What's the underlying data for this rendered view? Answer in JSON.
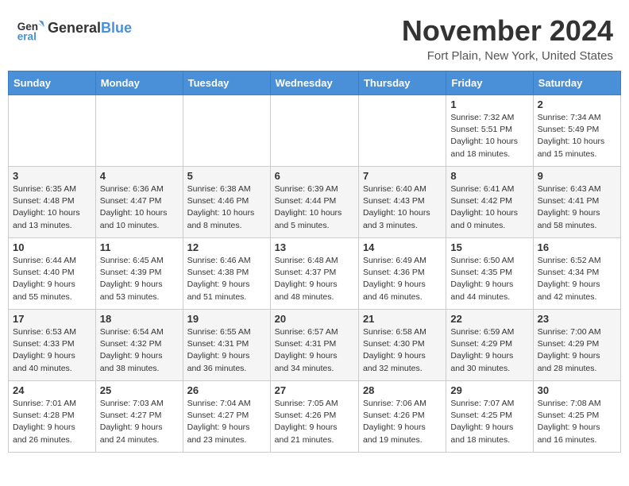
{
  "header": {
    "logo_general": "General",
    "logo_blue": "Blue",
    "month_title": "November 2024",
    "location": "Fort Plain, New York, United States"
  },
  "days_of_week": [
    "Sunday",
    "Monday",
    "Tuesday",
    "Wednesday",
    "Thursday",
    "Friday",
    "Saturday"
  ],
  "weeks": [
    [
      {
        "day": "",
        "info": ""
      },
      {
        "day": "",
        "info": ""
      },
      {
        "day": "",
        "info": ""
      },
      {
        "day": "",
        "info": ""
      },
      {
        "day": "",
        "info": ""
      },
      {
        "day": "1",
        "info": "Sunrise: 7:32 AM\nSunset: 5:51 PM\nDaylight: 10 hours\nand 18 minutes."
      },
      {
        "day": "2",
        "info": "Sunrise: 7:34 AM\nSunset: 5:49 PM\nDaylight: 10 hours\nand 15 minutes."
      }
    ],
    [
      {
        "day": "3",
        "info": "Sunrise: 6:35 AM\nSunset: 4:48 PM\nDaylight: 10 hours\nand 13 minutes."
      },
      {
        "day": "4",
        "info": "Sunrise: 6:36 AM\nSunset: 4:47 PM\nDaylight: 10 hours\nand 10 minutes."
      },
      {
        "day": "5",
        "info": "Sunrise: 6:38 AM\nSunset: 4:46 PM\nDaylight: 10 hours\nand 8 minutes."
      },
      {
        "day": "6",
        "info": "Sunrise: 6:39 AM\nSunset: 4:44 PM\nDaylight: 10 hours\nand 5 minutes."
      },
      {
        "day": "7",
        "info": "Sunrise: 6:40 AM\nSunset: 4:43 PM\nDaylight: 10 hours\nand 3 minutes."
      },
      {
        "day": "8",
        "info": "Sunrise: 6:41 AM\nSunset: 4:42 PM\nDaylight: 10 hours\nand 0 minutes."
      },
      {
        "day": "9",
        "info": "Sunrise: 6:43 AM\nSunset: 4:41 PM\nDaylight: 9 hours\nand 58 minutes."
      }
    ],
    [
      {
        "day": "10",
        "info": "Sunrise: 6:44 AM\nSunset: 4:40 PM\nDaylight: 9 hours\nand 55 minutes."
      },
      {
        "day": "11",
        "info": "Sunrise: 6:45 AM\nSunset: 4:39 PM\nDaylight: 9 hours\nand 53 minutes."
      },
      {
        "day": "12",
        "info": "Sunrise: 6:46 AM\nSunset: 4:38 PM\nDaylight: 9 hours\nand 51 minutes."
      },
      {
        "day": "13",
        "info": "Sunrise: 6:48 AM\nSunset: 4:37 PM\nDaylight: 9 hours\nand 48 minutes."
      },
      {
        "day": "14",
        "info": "Sunrise: 6:49 AM\nSunset: 4:36 PM\nDaylight: 9 hours\nand 46 minutes."
      },
      {
        "day": "15",
        "info": "Sunrise: 6:50 AM\nSunset: 4:35 PM\nDaylight: 9 hours\nand 44 minutes."
      },
      {
        "day": "16",
        "info": "Sunrise: 6:52 AM\nSunset: 4:34 PM\nDaylight: 9 hours\nand 42 minutes."
      }
    ],
    [
      {
        "day": "17",
        "info": "Sunrise: 6:53 AM\nSunset: 4:33 PM\nDaylight: 9 hours\nand 40 minutes."
      },
      {
        "day": "18",
        "info": "Sunrise: 6:54 AM\nSunset: 4:32 PM\nDaylight: 9 hours\nand 38 minutes."
      },
      {
        "day": "19",
        "info": "Sunrise: 6:55 AM\nSunset: 4:31 PM\nDaylight: 9 hours\nand 36 minutes."
      },
      {
        "day": "20",
        "info": "Sunrise: 6:57 AM\nSunset: 4:31 PM\nDaylight: 9 hours\nand 34 minutes."
      },
      {
        "day": "21",
        "info": "Sunrise: 6:58 AM\nSunset: 4:30 PM\nDaylight: 9 hours\nand 32 minutes."
      },
      {
        "day": "22",
        "info": "Sunrise: 6:59 AM\nSunset: 4:29 PM\nDaylight: 9 hours\nand 30 minutes."
      },
      {
        "day": "23",
        "info": "Sunrise: 7:00 AM\nSunset: 4:29 PM\nDaylight: 9 hours\nand 28 minutes."
      }
    ],
    [
      {
        "day": "24",
        "info": "Sunrise: 7:01 AM\nSunset: 4:28 PM\nDaylight: 9 hours\nand 26 minutes."
      },
      {
        "day": "25",
        "info": "Sunrise: 7:03 AM\nSunset: 4:27 PM\nDaylight: 9 hours\nand 24 minutes."
      },
      {
        "day": "26",
        "info": "Sunrise: 7:04 AM\nSunset: 4:27 PM\nDaylight: 9 hours\nand 23 minutes."
      },
      {
        "day": "27",
        "info": "Sunrise: 7:05 AM\nSunset: 4:26 PM\nDaylight: 9 hours\nand 21 minutes."
      },
      {
        "day": "28",
        "info": "Sunrise: 7:06 AM\nSunset: 4:26 PM\nDaylight: 9 hours\nand 19 minutes."
      },
      {
        "day": "29",
        "info": "Sunrise: 7:07 AM\nSunset: 4:25 PM\nDaylight: 9 hours\nand 18 minutes."
      },
      {
        "day": "30",
        "info": "Sunrise: 7:08 AM\nSunset: 4:25 PM\nDaylight: 9 hours\nand 16 minutes."
      }
    ]
  ]
}
